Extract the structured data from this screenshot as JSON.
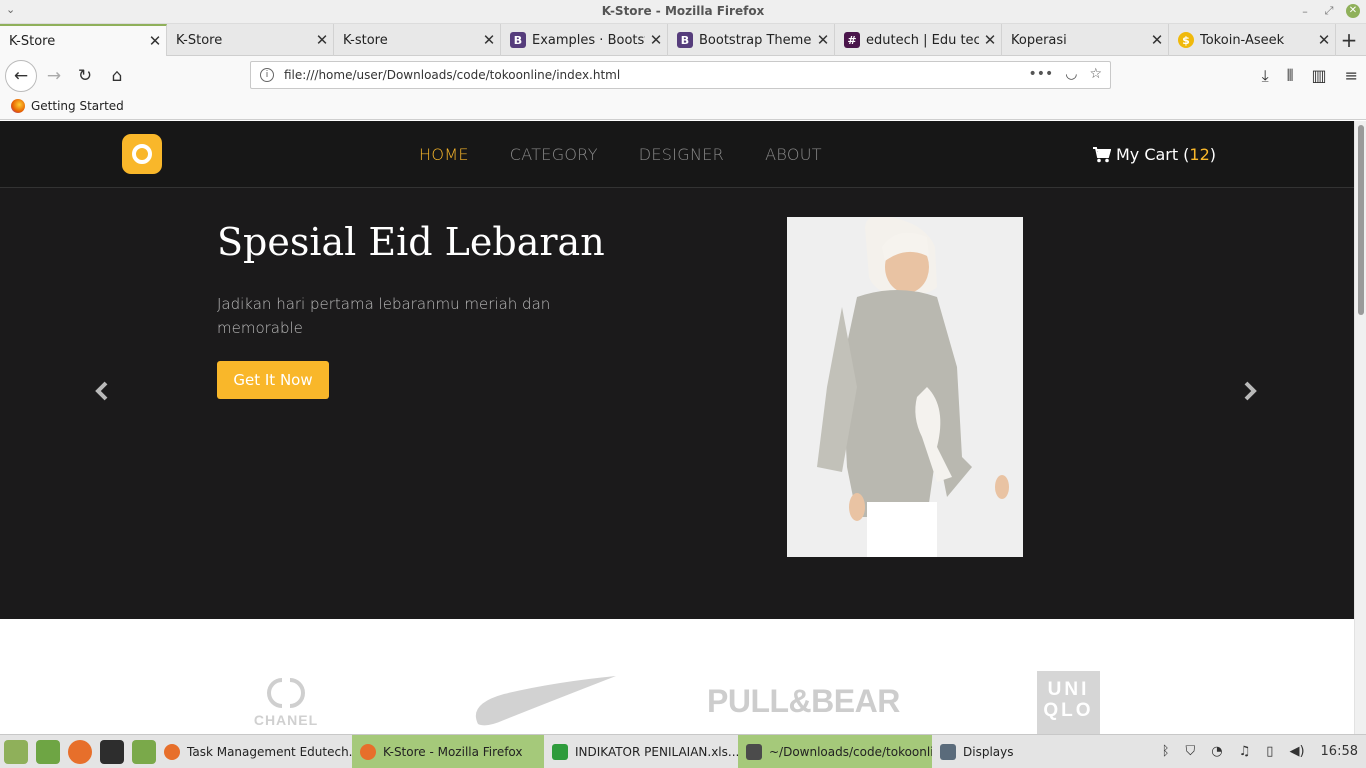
{
  "window": {
    "title": "K-Store - Mozilla Firefox"
  },
  "tabs": [
    {
      "label": "K-Store",
      "favicon": "none",
      "active": true
    },
    {
      "label": "K-Store",
      "favicon": "none"
    },
    {
      "label": "K-store",
      "favicon": "none"
    },
    {
      "label": "Examples · Bootstr",
      "favicon": "bootstrap-icon"
    },
    {
      "label": "Bootstrap Themes",
      "favicon": "bootstrap-icon"
    },
    {
      "label": "edutech | Edu tech",
      "favicon": "slack-icon"
    },
    {
      "label": "Koperasi",
      "favicon": "none"
    },
    {
      "label": "Tokoin-Aseek",
      "favicon": "coin-icon"
    }
  ],
  "navbar": {
    "url": "file:///home/user/Downloads/code/tokoonline/index.html"
  },
  "bookmarks": [
    {
      "label": "Getting Started"
    }
  ],
  "site": {
    "menu": [
      {
        "label": "HOME",
        "active": true
      },
      {
        "label": "CATEGORY"
      },
      {
        "label": "DESIGNER"
      },
      {
        "label": "ABOUT"
      }
    ],
    "cart": {
      "label": "My Cart",
      "count": "12",
      "open_paren": "(",
      "close_paren": ")"
    },
    "hero": {
      "title": "Spesial Eid Lebaran",
      "subtitle": "Jadikan hari pertama lebaranmu meriah dan memorable",
      "button": "Get It Now"
    },
    "brands": {
      "chanel": "CHANEL",
      "pullbear": "PULL&BEAR",
      "uniqlo_line1": "UNI",
      "uniqlo_line2": "QLO"
    }
  },
  "taskbar": {
    "items": [
      {
        "label": "Task Management Edutech..."
      },
      {
        "label": "K-Store - Mozilla Firefox",
        "active": true
      },
      {
        "label": "INDIKATOR PENILAIAN.xls..."
      },
      {
        "label": "~/Downloads/code/tokoonli..."
      },
      {
        "label": "Displays"
      }
    ],
    "clock": "16:58"
  },
  "colors": {
    "accent": "#f9b72a",
    "hero_bg": "#1b1a1b",
    "header_bg": "#171717",
    "taskbar_active": "#a5c97a"
  }
}
